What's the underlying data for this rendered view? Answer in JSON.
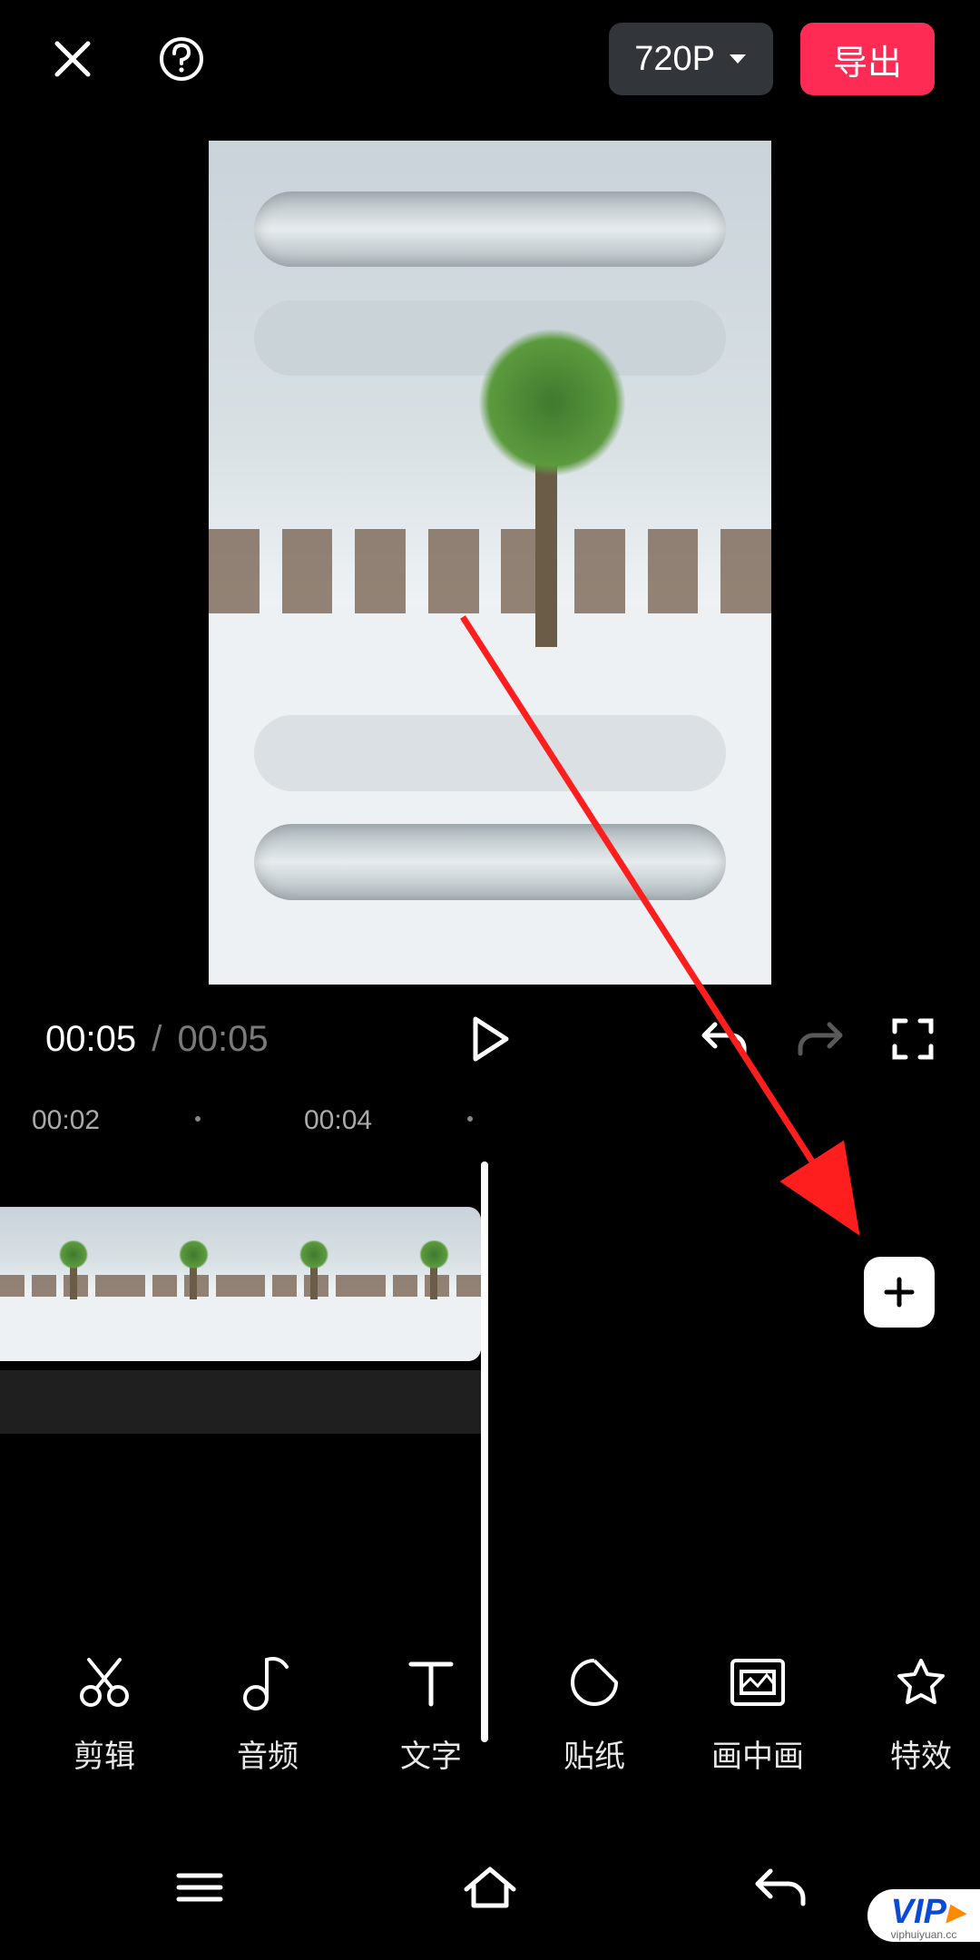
{
  "header": {
    "resolution_label": "720P",
    "export_label": "导出"
  },
  "playback": {
    "current_time": "00:05",
    "separator": "/",
    "duration": "00:05"
  },
  "ruler": {
    "ticks": [
      "00:02",
      "00:04"
    ]
  },
  "toolbar": {
    "items": [
      {
        "icon": "scissors",
        "label": "剪辑"
      },
      {
        "icon": "music-note",
        "label": "音频"
      },
      {
        "icon": "text-t",
        "label": "文字"
      },
      {
        "icon": "sticker",
        "label": "贴纸"
      },
      {
        "icon": "pip",
        "label": "画中画"
      },
      {
        "icon": "star",
        "label": "特效"
      }
    ]
  },
  "watermark": {
    "text": "VIP",
    "sub": "viphuiyuan.cc"
  },
  "annotation": {
    "arrow_from": "preview-center",
    "arrow_to": "add-clip-button",
    "arrow_color": "#ff1e1e"
  }
}
